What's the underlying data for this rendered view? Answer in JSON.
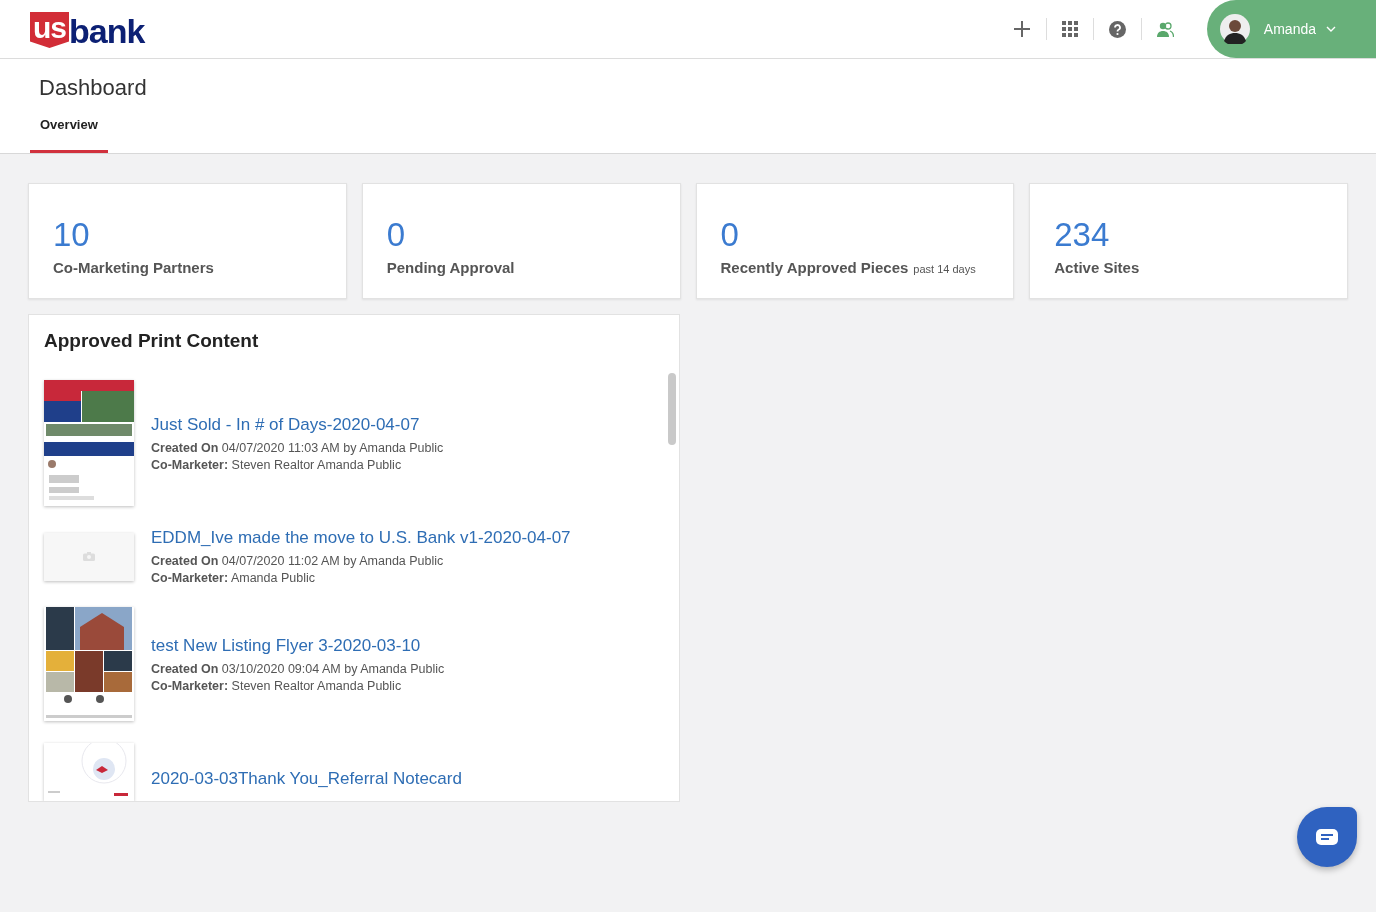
{
  "header": {
    "logo": {
      "shield_text": "us",
      "wordmark": "bank"
    },
    "user": {
      "name": "Amanda"
    }
  },
  "page": {
    "title": "Dashboard",
    "tabs": [
      {
        "label": "Overview",
        "selected": true
      }
    ]
  },
  "stats": [
    {
      "value": "10",
      "label": "Co-Marketing Partners"
    },
    {
      "value": "0",
      "label": "Pending Approval"
    },
    {
      "value": "0",
      "label": "Recently Approved Pieces",
      "note": "past 14 days"
    },
    {
      "value": "234",
      "label": "Active Sites"
    }
  ],
  "approved": {
    "title": "Approved Print Content",
    "items": [
      {
        "kind": "flyer",
        "title": "Just Sold - In # of Days-2020-04-07",
        "created_label": "Created On",
        "created": "04/07/2020 11:03 AM by Amanda Public",
        "comarketer_label": "Co-Marketer:",
        "comarketer": "Steven Realtor Amanda Public"
      },
      {
        "kind": "placeholder",
        "title": "EDDM_Ive made the move to U.S. Bank v1-2020-04-07",
        "created_label": "Created On",
        "created": "04/07/2020 11:02 AM by Amanda Public",
        "comarketer_label": "Co-Marketer:",
        "comarketer": "Amanda Public"
      },
      {
        "kind": "listing",
        "title": "test New Listing Flyer 3-2020-03-10",
        "created_label": "Created On",
        "created": "03/10/2020 09:04 AM by Amanda Public",
        "comarketer_label": "Co-Marketer:",
        "comarketer": "Steven Realtor Amanda Public"
      },
      {
        "kind": "notecard",
        "title": "2020-03-03Thank You_Referral Notecard"
      }
    ]
  }
}
